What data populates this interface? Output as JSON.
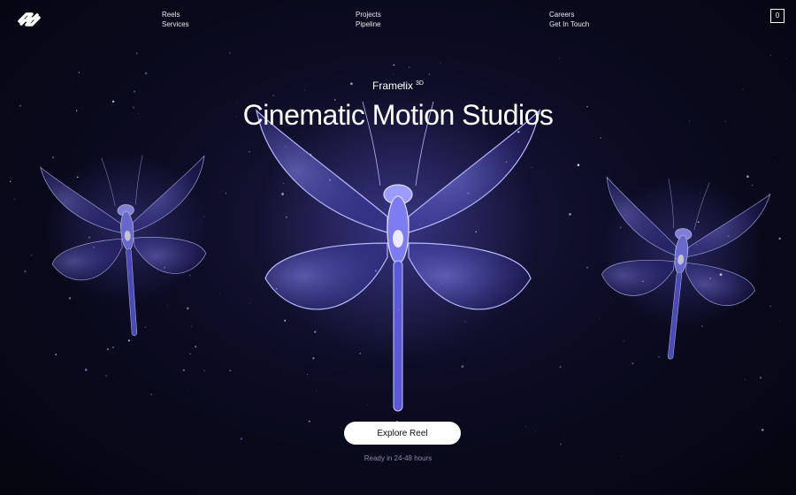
{
  "nav": {
    "columns": [
      [
        "Reels",
        "Services"
      ],
      [
        "Projects",
        "Pipeline"
      ],
      [
        "Careers",
        "Get In Touch"
      ]
    ],
    "cart_count": "0"
  },
  "hero": {
    "brand": "Framelix",
    "brand_sup": "3D",
    "headline": "Cinematic Motion Studios",
    "cta_label": "Explore Reel",
    "note": "Ready in 24-48 hours"
  },
  "icons": [
    "logo-icon",
    "dragonfly-illustration"
  ],
  "colors": {
    "glow": "#6d6bff",
    "background": "#0c0b22"
  }
}
